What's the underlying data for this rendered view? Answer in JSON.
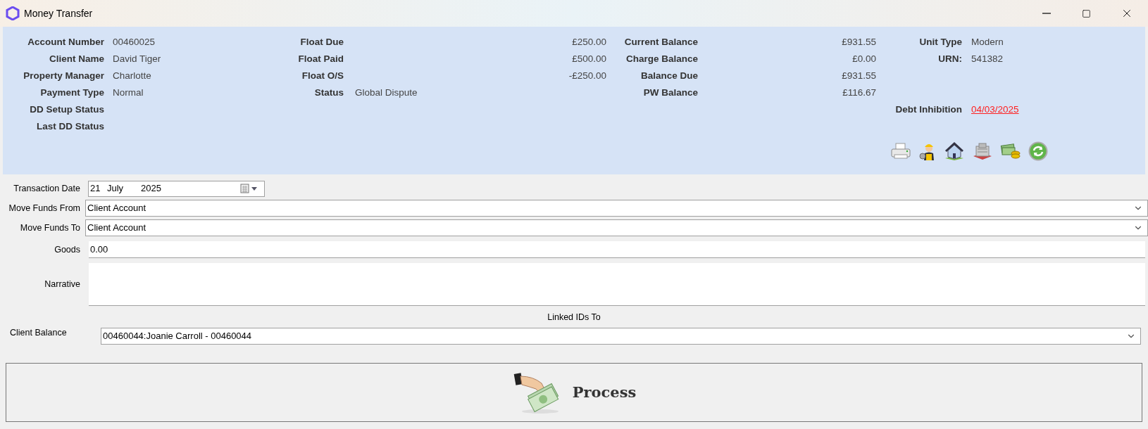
{
  "window": {
    "title": "Money Transfer"
  },
  "account_info": [
    {
      "label": "Account Number",
      "value": "00460025"
    },
    {
      "label": "Client Name",
      "value": "David Tiger"
    },
    {
      "label": "Property Manager",
      "value": "Charlotte"
    },
    {
      "label": "Payment Type",
      "value": "Normal"
    },
    {
      "label": "DD Setup Status"
    },
    {
      "label": "Last DD Status"
    }
  ],
  "float_info": [
    {
      "label": "Float Due",
      "value": "£250.00",
      "kind": "amount"
    },
    {
      "label": "Float Paid",
      "value": "£500.00",
      "kind": "amount"
    },
    {
      "label": "Float O/S",
      "value": "-£250.00",
      "kind": "amount"
    },
    {
      "label": "Status",
      "value": "Global Dispute",
      "kind": "text"
    }
  ],
  "balances": [
    {
      "label": "Current Balance",
      "value": "£931.55"
    },
    {
      "label": "Charge Balance",
      "value": "£0.00"
    },
    {
      "label": "Balance Due",
      "value": "£931.55"
    },
    {
      "label": "PW Balance",
      "value": "£116.67"
    }
  ],
  "unit_info": [
    {
      "label": "Unit Type",
      "value": "Modern"
    },
    {
      "label": "URN:",
      "value": "541382"
    }
  ],
  "debt_inhibition": {
    "label": "Debt Inhibition",
    "value": "04/03/2025"
  },
  "form": {
    "transaction_date": {
      "label": "Transaction Date",
      "day": "21",
      "month": "July",
      "year": "2025"
    },
    "move_funds_from": {
      "label": "Move Funds From",
      "value": "Client Account"
    },
    "move_funds_to": {
      "label": "Move Funds To",
      "value": "Client Account"
    },
    "goods": {
      "label": "Goods",
      "value": "0.00"
    },
    "narrative": {
      "label": "Narrative"
    },
    "linked_ids_heading": "Linked IDs To",
    "client_balance": {
      "label": "Client Balance",
      "value": "00460044:Joanie Carroll - 00460044"
    }
  },
  "process_button": "Process"
}
